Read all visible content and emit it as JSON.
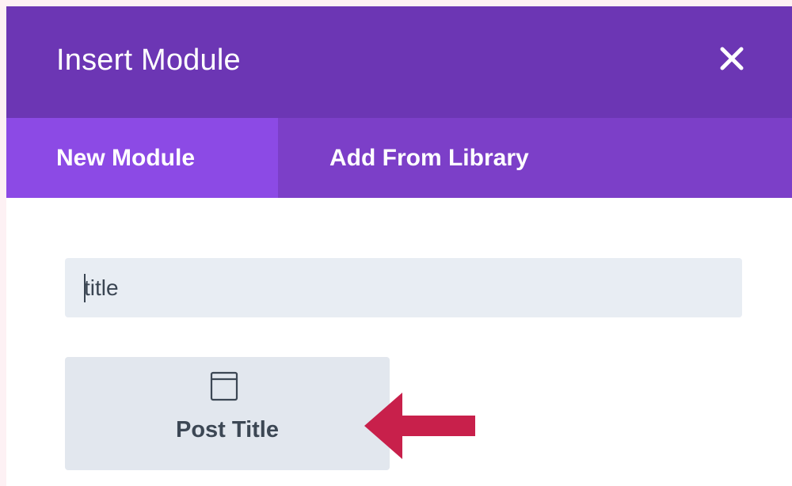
{
  "header": {
    "title": "Insert Module",
    "close_icon": "close-icon"
  },
  "tabs": [
    {
      "label": "New Module",
      "active": true
    },
    {
      "label": "Add From Library",
      "active": false
    }
  ],
  "search": {
    "value": "title",
    "placeholder": ""
  },
  "modules": [
    {
      "label": "Post Title",
      "icon": "post-title-icon"
    }
  ],
  "annotation": {
    "icon": "arrow-left-icon"
  },
  "colors": {
    "header_bg": "#6c36b4",
    "tabs_bg": "#7c3fc8",
    "active_tab_bg": "#8c4ae5",
    "arrow": "#c8204b",
    "card_bg": "#e2e7ee",
    "search_bg": "#e8edf3"
  }
}
